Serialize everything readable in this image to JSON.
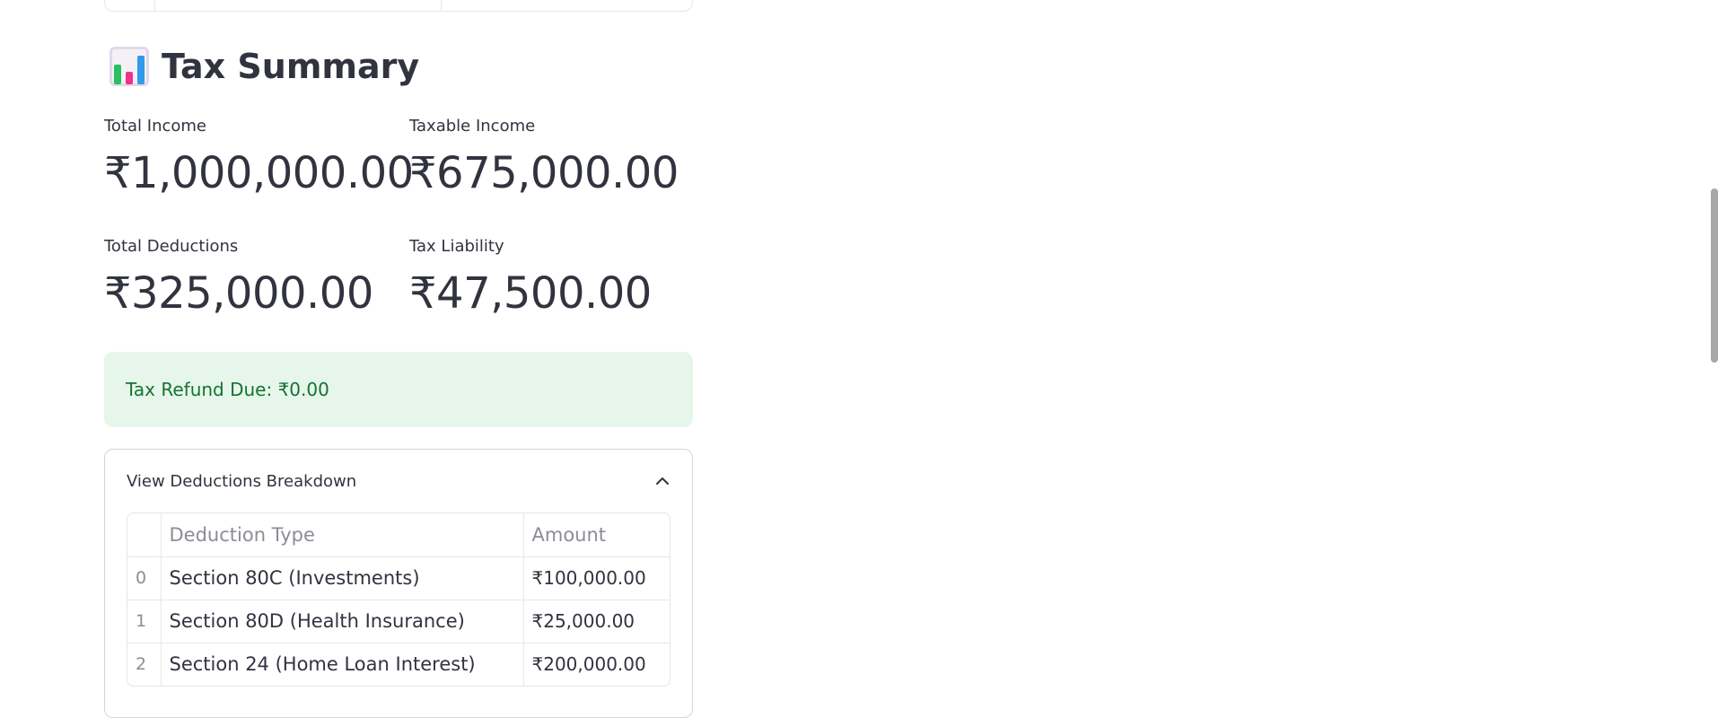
{
  "section": {
    "title": "Tax Summary",
    "icon": "bar-chart-icon"
  },
  "metrics": {
    "total_income": {
      "label": "Total Income",
      "value": "₹1,000,000.00"
    },
    "taxable_income": {
      "label": "Taxable Income",
      "value": "₹675,000.00"
    },
    "total_deductions": {
      "label": "Total Deductions",
      "value": "₹325,000.00"
    },
    "tax_liability": {
      "label": "Tax Liability",
      "value": "₹47,500.00"
    }
  },
  "alert": {
    "text": "Tax Refund Due: ₹0.00",
    "color": "#177233",
    "background": "#e6f6ea"
  },
  "expander": {
    "label": "View Deductions Breakdown",
    "expanded": true,
    "icon": "chevron-up-icon"
  },
  "deductions_table": {
    "columns": [
      "",
      "Deduction Type",
      "Amount"
    ],
    "rows": [
      [
        "0",
        "Section 80C (Investments)",
        "₹100,000.00"
      ],
      [
        "1",
        "Section 80D (Health Insurance)",
        "₹25,000.00"
      ],
      [
        "2",
        "Section 24 (Home Loan Interest)",
        "₹200,000.00"
      ]
    ]
  }
}
